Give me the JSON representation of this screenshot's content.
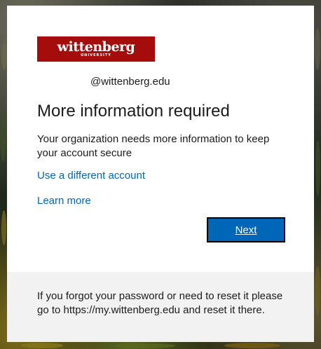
{
  "brand": {
    "logo_word": "wittenberg",
    "logo_sub": "UNIVERSITY",
    "logo_color": "#a50d0d"
  },
  "identity": {
    "email_domain": "@wittenberg.edu"
  },
  "main": {
    "title": "More information required",
    "description": "Your organization needs more information to keep your account secure",
    "links": {
      "different_account": "Use a different account",
      "learn_more": "Learn more"
    },
    "next_label": "Next",
    "accent_color": "#0067b8"
  },
  "footer": {
    "text": "If you forgot your password or need to reset it please go to https://my.wittenberg.edu and reset it there."
  }
}
